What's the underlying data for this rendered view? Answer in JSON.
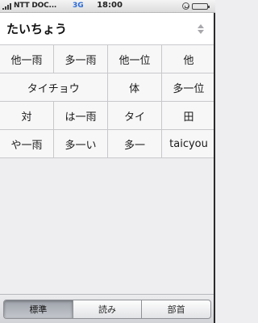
{
  "status_bar": {
    "carrier": "NTT DOC...",
    "network": "3G",
    "time": "18:00",
    "signal_bars": 4
  },
  "input": {
    "text": "たいちょう"
  },
  "candidates": {
    "rows": [
      [
        "他一雨",
        "多一雨",
        "他一位",
        "他"
      ],
      [
        "タイチョウ",
        "体",
        "多一位"
      ],
      [
        "対",
        "は一雨",
        "タイ",
        "田"
      ],
      [
        "や一雨",
        "多一い",
        "多一",
        "taicyou"
      ]
    ]
  },
  "segment": {
    "items": [
      "標準",
      "読み",
      "部首"
    ],
    "selected": "標準"
  }
}
